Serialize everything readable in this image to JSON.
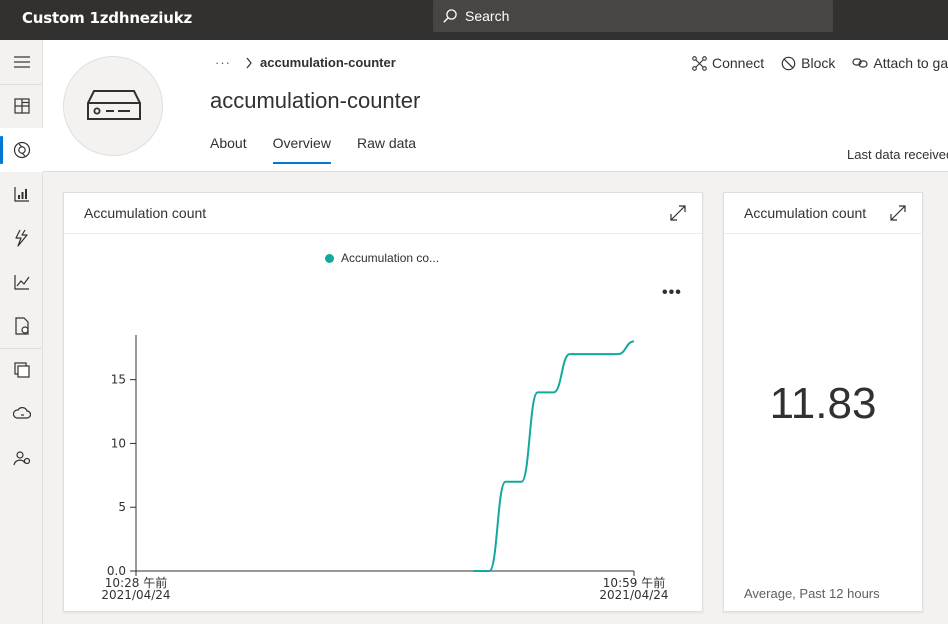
{
  "app": {
    "title": "Custom 1zdhneziukz"
  },
  "search": {
    "label": "Search"
  },
  "nav": {
    "items": [
      {
        "icon": "hamburger-menu-icon"
      },
      {
        "icon": "dashboard-icon"
      },
      {
        "icon": "devices-icon",
        "active": true
      },
      {
        "icon": "device-groups-icon"
      },
      {
        "icon": "rules-icon"
      },
      {
        "icon": "analytics-icon"
      },
      {
        "icon": "jobs-icon"
      },
      {
        "icon": "device-templates-icon"
      },
      {
        "icon": "data-export-icon"
      },
      {
        "icon": "administration-icon"
      }
    ]
  },
  "device": {
    "breadcrumb_more": "···",
    "breadcrumb": "accumulation-counter",
    "name": "accumulation-counter",
    "tabs": [
      "About",
      "Overview",
      "Raw data"
    ],
    "selected_tab": "Overview",
    "last_data": "Last data received"
  },
  "actions": {
    "connect": "Connect",
    "block": "Block",
    "attach": "Attach to gateway"
  },
  "chart_card": {
    "title": "Accumulation count",
    "legend": "Accumulation co...",
    "more": "•••"
  },
  "kpi_card": {
    "title": "Accumulation count",
    "value": "11.83",
    "caption": "Average, Past 12 hours"
  },
  "chart_data": {
    "type": "line",
    "title": "Accumulation count",
    "series": [
      {
        "name": "Accumulation co...",
        "color": "#13a89e",
        "x": [
          "10:49",
          "10:50",
          "10:51",
          "10:52",
          "10:53",
          "10:54",
          "10:55",
          "10:56",
          "10:57",
          "10:58",
          "10:59"
        ],
        "y": [
          0,
          0,
          7,
          7,
          14,
          14,
          17,
          17,
          17,
          17,
          18
        ]
      }
    ],
    "x_ticks": [
      {
        "line1": "10:28 午前",
        "line2": "2021/04/24"
      },
      {
        "line1": "10:59 午前",
        "line2": "2021/04/24"
      }
    ],
    "xlim": [
      "10:28",
      "10:59"
    ],
    "y_ticks": [
      "0.0",
      "5",
      "10",
      "15"
    ],
    "ylim": [
      0,
      18.5
    ],
    "grid": false
  }
}
